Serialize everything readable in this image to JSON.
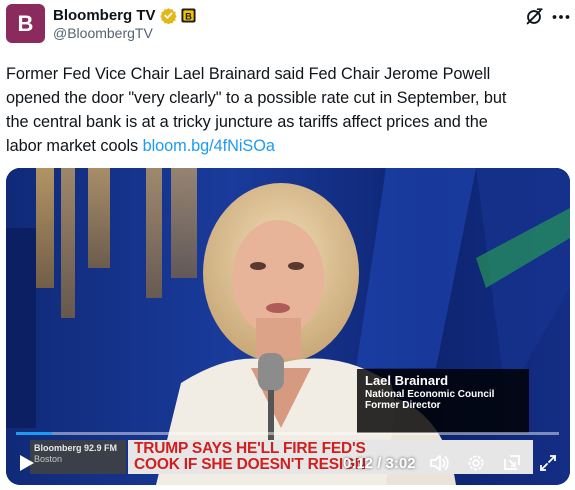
{
  "post": {
    "author": {
      "display_name": "Bloomberg TV",
      "handle": "@BloombergTV",
      "avatar_letter": "B",
      "avatar_color": "#8b2a5c",
      "verified_badge": "gold-check-icon",
      "affiliation_badge": "bloomberg-affiliate-icon"
    },
    "text_lines": [
      "Former Fed Vice Chair Lael Brainard said Fed Chair Jerome Powell",
      "opened the door \"very clearly\" to a possible rate cut in September, but",
      "the central bank is at a tricky juncture as tariffs affect prices and the",
      "labor market cools "
    ],
    "link_text": "bloom.bg/4fNiSOa",
    "link_color": "#1d9bf0",
    "header_icons": [
      "grok-icon",
      "more-icon"
    ]
  },
  "video": {
    "lower_third": {
      "name": "Lael Brainard",
      "title_line1": "National Economic Council",
      "title_line2": "Former Director"
    },
    "ticker": {
      "station": "Bloomberg 92.9 FM",
      "city": "Boston",
      "headline_line1": "TRUMP SAYS HE'LL FIRE FED'S",
      "headline_line2": "COOK IF SHE DOESN'T RESIGN"
    },
    "player": {
      "current_time": "0:12",
      "duration": "3:02",
      "time_display": "0:12 / 3:02",
      "progress_fraction": 0.066,
      "icons": [
        "play-icon",
        "volume-icon",
        "settings-icon",
        "picture-in-picture-icon",
        "fullscreen-icon"
      ]
    }
  }
}
